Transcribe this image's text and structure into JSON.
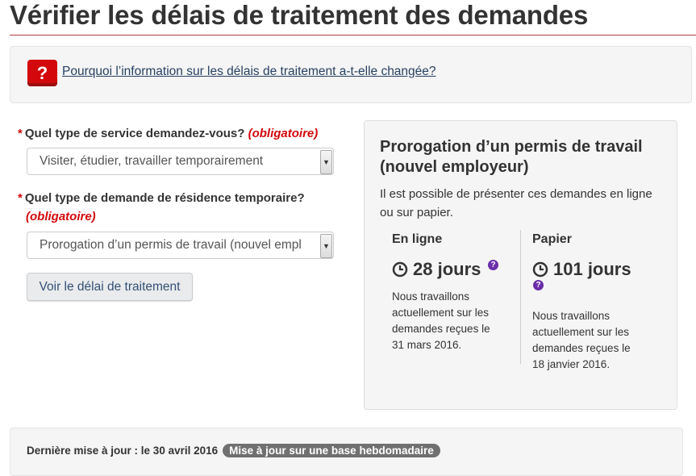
{
  "page": {
    "title": "Vérifier les délais de traitement des demandes"
  },
  "info": {
    "icon_symbol": "?",
    "link_text": "Pourquoi l’information sur les délais de traitement a-t-elle changée?"
  },
  "form": {
    "required_marker": "*",
    "service_label": "Quel type de service demandez-vous?",
    "service_required": "(obligatoire)",
    "service_value": "Visiter, étudier, travailler temporairement",
    "residence_label": "Quel type de demande de résidence temporaire?",
    "residence_required": "(obligatoire)",
    "residence_value": "Prorogation d’un permis de travail (nouvel empl",
    "submit_label": "Voir le délai de traitement"
  },
  "result": {
    "title": "Prorogation d’un permis de travail (nouvel employeur)",
    "intro": "Il est possible de présenter ces demandes en ligne ou sur papier.",
    "online": {
      "heading": "En ligne",
      "days": "28 jours",
      "note": "Nous travaillons actuellement sur les demandes reçues le 31 mars 2016."
    },
    "paper": {
      "heading": "Papier",
      "days": "101 jours",
      "note": "Nous travaillons actuellement sur les demandes reçues le 18 janvier 2016."
    }
  },
  "footer": {
    "updated_text": "Dernière mise à jour : le 30 avril 2016",
    "badge": "Mise à jour sur une base hebdomadaire"
  },
  "colors": {
    "accent_red": "#d3080c",
    "link_blue": "#284162",
    "help_purple": "#6a2ea8"
  }
}
